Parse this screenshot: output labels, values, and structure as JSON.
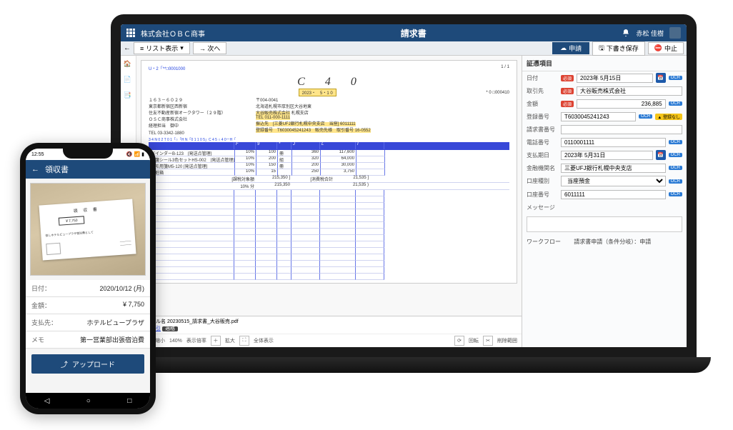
{
  "laptop": {
    "company": "株式会社ＯＢＣ商事",
    "docTitle": "請求書",
    "userName": "赤松 佳樹",
    "toolbar": {
      "listView": "リスト表示",
      "next": "→ 次へ",
      "submit": "申請",
      "draftSave": "下書き保存",
      "cancel": "中止"
    },
    "document": {
      "topLeftCode": "U・2「**□0001000",
      "topRightPage": "1 / 1",
      "topRightCode": "* 0 □000410",
      "bigLabel": "C　4　0",
      "dateBox": "2023・　5・1 0",
      "sender": {
        "zip": "１６３－６０２９",
        "addr1": "東京都新宿区西新宿",
        "addr2": "住友不動産新宿オークタワー（２９階）",
        "addr3": "ＯＳＣ商事株式会社",
        "addr4": "経理担当　御中",
        "tel": "TEL 03-3342-1880"
      },
      "recipient": {
        "zip": "〒004-0041",
        "addr1": "北海道札幌市厚別区大谷地東",
        "company": "大谷販売株式会社",
        "branch": "札幌支店",
        "tel": "TEL 011-000-1111",
        "bank": "振込先　[三菱UFJ銀行札幌中央支店　当座] 6011111",
        "reg": "登録番号　T6030045241243　販売先様　取引番号 16-0552"
      },
      "colHeaderLine": "3 4 N 0 2 T 0 1「○「H N「0 1 1 0 5」C 4 5 ○ 4 0ーH「",
      "rows": [
        {
          "name": "バインダーB-123　[発送点管理]",
          "rate": "10%",
          "qty": "100",
          "unit": "冊",
          "price": "360",
          "amt": "117,600",
          "amt2": ""
        },
        {
          "name": "付箋シール3色セットHS-002　[発送点管理]",
          "rate": "10%",
          "qty": "200",
          "unit": "組",
          "price": "320",
          "amt": "64,000",
          "amt2": ""
        },
        {
          "name": "メモ用箋M5-120 [発送点管理]",
          "rate": "10%",
          "qty": "150",
          "unit": "冊",
          "price": "200",
          "amt": "30,000",
          "amt2": ""
        },
        {
          "name": "化粧箱",
          "rate": "10%",
          "qty": "15",
          "unit": "",
          "price": "250",
          "amt": "3,750",
          "amt2": ""
        }
      ],
      "summary": {
        "label1": "[課税対象額",
        "val1": "215,350 ]",
        "label2": "[消費税合計",
        "val2": "21,535 ]",
        "rateLabel": "10% 分",
        "rateVal1": "215,350",
        "rateVal2": "21,535 )"
      },
      "fileLabel": "ファイル名",
      "fileName": "20230515_請求書_大谷販売.pdf",
      "eRetain": "電子取引",
      "qualified": "適格",
      "zoom": {
        "minus": "縮小",
        "ratio": "140%",
        "label": "表示倍率",
        "plus": "拡大",
        "fit": "全体表示",
        "rotate": "回転",
        "crop": "削除範囲"
      }
    },
    "form": {
      "title": "証憑項目",
      "date": {
        "label": "日付",
        "value": "2023年 5月15日"
      },
      "vendor": {
        "label": "取引先",
        "value": "大谷販売株式会社"
      },
      "amount": {
        "label": "金額",
        "value": "236,885"
      },
      "regNo": {
        "label": "登録番号",
        "value": "T6030045241243"
      },
      "regWarn": "▲ 登録なし",
      "invoiceNo": {
        "label": "請求書番号",
        "value": ""
      },
      "phone": {
        "label": "電話番号",
        "value": "0110001111"
      },
      "dueDate": {
        "label": "支払期日",
        "value": "2023年 5月31日"
      },
      "bank": {
        "label": "金融機関名",
        "value": "三菱UFJ銀行札幌中央支店"
      },
      "acctType": {
        "label": "口座種別",
        "value": "当座預金"
      },
      "acctNo": {
        "label": "口座番号",
        "value": "6011111"
      },
      "msgLabel": "メッセージ",
      "wfLabel": "ワークフロー",
      "wfValue": "請求書申請（条件分岐）：申請",
      "ocr": "OCR"
    }
  },
  "phone": {
    "time": "12:55",
    "title": "領収書",
    "receipt": {
      "title": "領 収 書",
      "amount": "￥7,750",
      "note": "但しホテルビュープラザ宿泊費として"
    },
    "rows": {
      "date": {
        "k": "日付：",
        "v": "2020/10/12 (月)"
      },
      "amount": {
        "k": "金額：",
        "v": "¥ 7,750"
      },
      "payee": {
        "k": "支払先：",
        "v": "ホテルビュープラザ"
      },
      "memo": {
        "k": "メモ",
        "v": "第一営業部出張宿泊費"
      }
    },
    "upload": "アップロード"
  }
}
